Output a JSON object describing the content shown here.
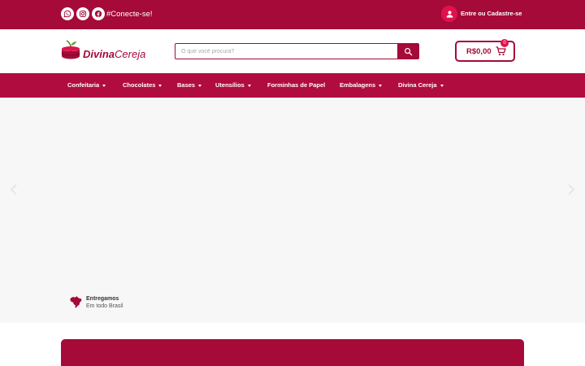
{
  "topbar": {
    "social": [
      {
        "icon": "whatsapp-icon"
      },
      {
        "icon": "instagram-icon"
      },
      {
        "icon": "facebook-icon"
      }
    ],
    "tagline": "#Conecte-se!",
    "login_text": "Entre ou Cadastre-se"
  },
  "header": {
    "logo": {
      "part1": "Divina",
      "part2": "Cereja"
    },
    "search": {
      "placeholder": "O que você procura?"
    },
    "cart": {
      "price": "R$0,00",
      "count": "0"
    }
  },
  "nav": {
    "items": [
      {
        "label": "Confeitaria"
      },
      {
        "label": "Chocolates"
      },
      {
        "label": "Bases"
      },
      {
        "label": "Utensílios"
      },
      {
        "label": "Forminhas de Papel"
      },
      {
        "label": "Embalagens"
      },
      {
        "label": "Divina Cereja"
      }
    ]
  },
  "delivery": {
    "title": "Entregamos",
    "subtitle": "Em todo Brasil"
  },
  "colors": {
    "brand": "#a50a39",
    "nav": "#b10c3f",
    "accent": "#e0124c"
  }
}
